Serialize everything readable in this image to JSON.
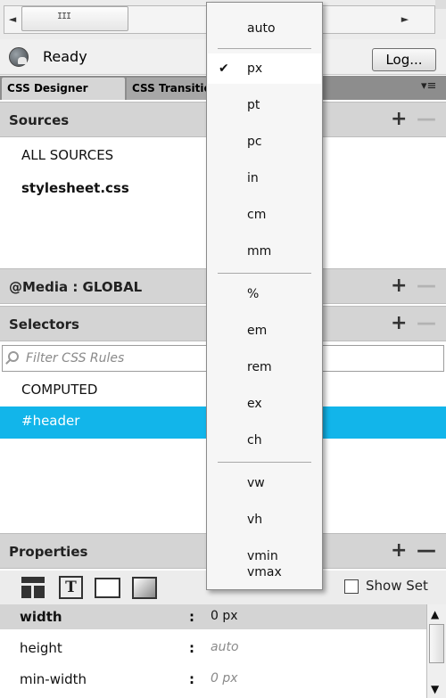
{
  "statusbar": {
    "status_text": "Ready",
    "log_button_label": "Log..."
  },
  "tabs": {
    "active": "CSS Designer",
    "inactive": "CSS Transitions"
  },
  "sources": {
    "title": "Sources",
    "items": [
      "ALL SOURCES",
      "stylesheet.css"
    ]
  },
  "media": {
    "title": "@Media :  GLOBAL"
  },
  "selectors": {
    "title": "Selectors",
    "filter_placeholder": "Filter CSS Rules",
    "items": [
      "COMPUTED",
      "#header"
    ]
  },
  "properties": {
    "title": "Properties",
    "show_set_label": "Show Set",
    "rows": [
      {
        "name": "width",
        "value": "0 px"
      },
      {
        "name": "height",
        "value": "auto"
      },
      {
        "name": "min-width",
        "value": "0 px"
      }
    ]
  },
  "dropdown": {
    "selected": "px",
    "items": [
      "auto",
      "px",
      "pt",
      "pc",
      "in",
      "cm",
      "mm",
      "%",
      "em",
      "rem",
      "ex",
      "ch",
      "vw",
      "vh",
      "vmin",
      "vmax"
    ]
  },
  "icons": {
    "scrollbar_grip": "III",
    "scroll_left": "◄",
    "scroll_right": "►",
    "tab_menu": "▾≡",
    "check": "✔",
    "plus": "+",
    "minus": "—"
  },
  "colors": {
    "selection": "#12b5ea",
    "panel_header": "#d4d4d4"
  }
}
